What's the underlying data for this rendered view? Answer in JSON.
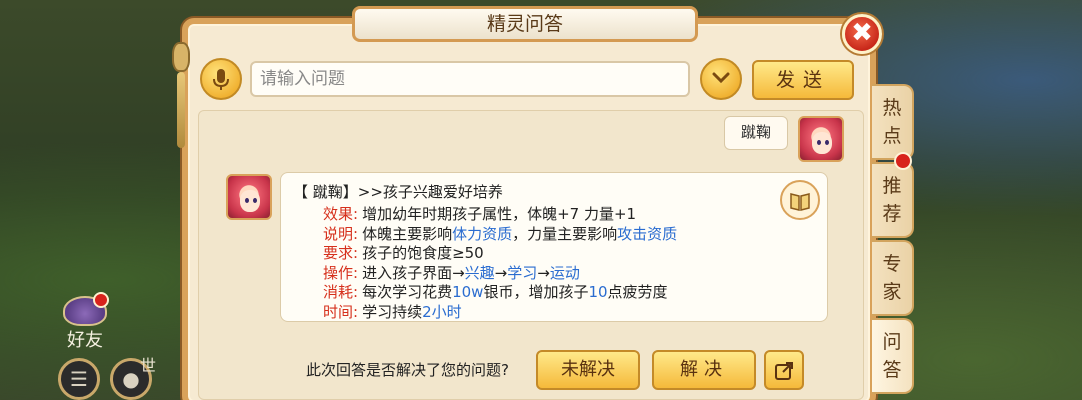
{
  "dialog": {
    "title": "精灵问答"
  },
  "search": {
    "placeholder": "请输入问题",
    "send_label": "发送"
  },
  "chat": {
    "user_message": "蹴鞠",
    "answer": {
      "title": "【 蹴鞠】>>孩子兴趣爱好培养",
      "rows": [
        {
          "key": "效果:",
          "parts": [
            "增加幼年时期孩子属性，体魄+7  力量+1"
          ]
        },
        {
          "key": "说明:",
          "parts": [
            "体魄主要影响",
            "体力资质",
            "，力量主要影响",
            "攻击资质"
          ]
        },
        {
          "key": "要求:",
          "parts": [
            "孩子的饱食度≥50"
          ]
        },
        {
          "key": "操作:",
          "parts": [
            "进入孩子界面→",
            "兴趣",
            "→",
            "学习",
            "→",
            "运动"
          ]
        },
        {
          "key": "消耗:",
          "parts": [
            "每次学习花费",
            "10w",
            "银币，增加孩子",
            "10",
            "点疲劳度"
          ]
        },
        {
          "key": "时间:",
          "parts": [
            "学习持续",
            "2小时"
          ]
        }
      ]
    }
  },
  "feedback": {
    "question": "此次回答是否解决了您的问题?",
    "unsolved_label": "未解决",
    "solved_label": "解决"
  },
  "tabs": [
    {
      "label": "热点"
    },
    {
      "label": "推荐"
    },
    {
      "label": "专家"
    },
    {
      "label": "问答"
    }
  ],
  "hud": {
    "friends_label": "好友",
    "world_label": "世"
  }
}
